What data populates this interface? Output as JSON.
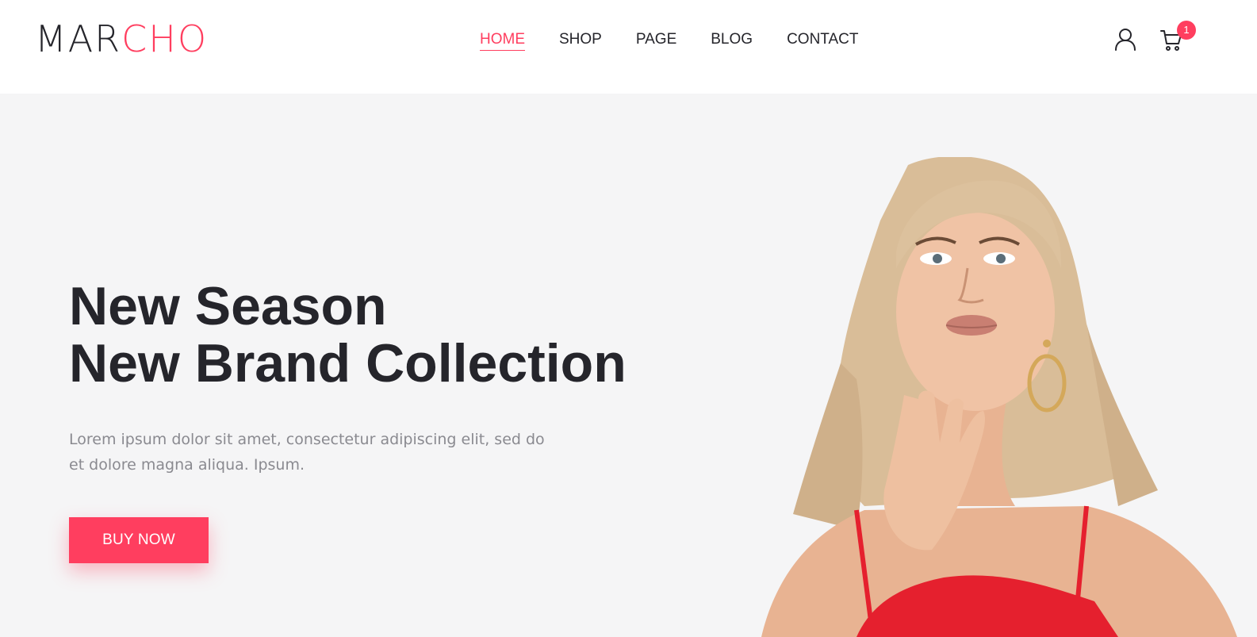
{
  "brand": {
    "logo_part1": "MAR",
    "logo_part2": "CHO",
    "accent_color": "#ff3e5f",
    "text_color": "#25252b"
  },
  "nav": {
    "items": [
      {
        "label": "HOME",
        "active": true
      },
      {
        "label": "SHOP",
        "active": false
      },
      {
        "label": "PAGE",
        "active": false
      },
      {
        "label": "BLOG",
        "active": false
      },
      {
        "label": "CONTACT",
        "active": false
      }
    ]
  },
  "header_icons": {
    "user_icon": "user-icon",
    "cart_icon": "cart-icon",
    "cart_count": "1"
  },
  "hero": {
    "title_line1": "New Season",
    "title_line2": "New Brand Collection",
    "description": "Lorem ipsum dolor sit amet, consectetur adipiscing elit, sed do et dolore magna aliqua. Ipsum.",
    "cta_label": "BUY NOW",
    "background_color": "#f5f5f6",
    "image": "model-photo"
  }
}
